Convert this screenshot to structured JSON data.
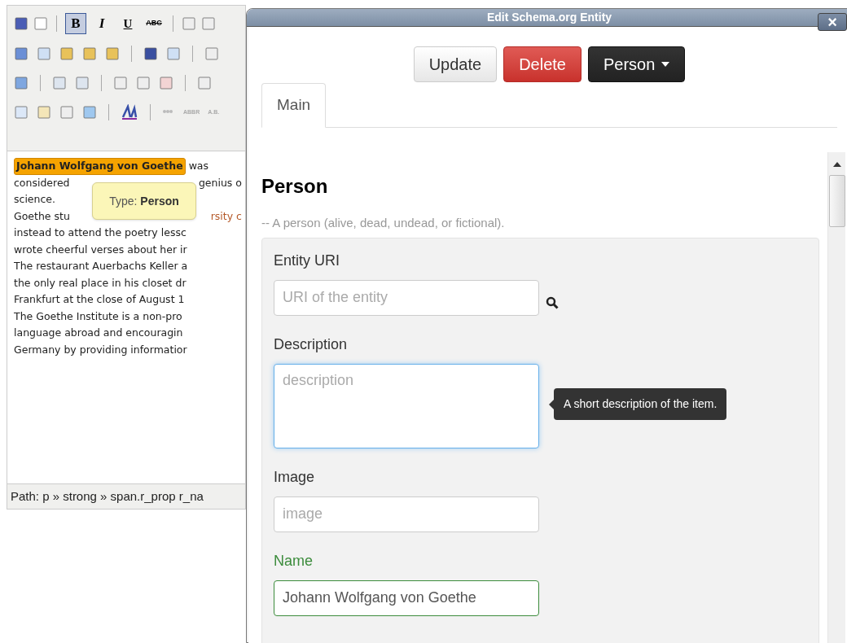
{
  "editor": {
    "format_buttons": [
      {
        "label": "B",
        "selected": true
      },
      {
        "label": "I",
        "selected": false
      },
      {
        "label": "U",
        "selected": false
      },
      {
        "label": "ABC",
        "selected": false
      }
    ],
    "small_buttons": [
      "ABBR",
      "A.B."
    ],
    "entity": "Johann Wolfgang von Goethe",
    "after_entity": "was",
    "lines": [
      {
        "left": "considered",
        "right": "genius o"
      },
      {
        "left": "science."
      },
      {
        "left": "Goethe stu",
        "right": "rsity c",
        "kind": "link"
      },
      {
        "left": "instead to attend the poetry lessc"
      },
      {
        "left": "wrote cheerful verses about her ir"
      },
      {
        "left": "The restaurant Auerbachs Keller a"
      },
      {
        "left": "the only real place in his closet dr"
      },
      {
        "left": "Frankfurt at the close of August 1"
      },
      {
        "left": "The Goethe Institute is a non-pro"
      },
      {
        "left": "language abroad and encouragin"
      },
      {
        "left": "Germany by providing informatior"
      }
    ],
    "type_tooltip": {
      "label": "Type:",
      "value": "Person"
    },
    "path": "Path: p » strong » span.r_prop r_na"
  },
  "dialog": {
    "title": "Edit Schema.org Entity",
    "close": "×",
    "buttons": [
      {
        "label": "Update",
        "kind": "default"
      },
      {
        "label": "Delete",
        "kind": "danger"
      },
      {
        "label": "Person",
        "kind": "dropdown"
      }
    ],
    "tabs": [
      {
        "label": "Main",
        "selected": true
      }
    ],
    "heading": "Person",
    "description": "-- A person (alive, dead, undead, or fictional).",
    "fields": [
      {
        "label": "Entity URI",
        "kind": "input",
        "placeholder": "URI of the entity",
        "focused": false,
        "valid": false,
        "search_button": true
      },
      {
        "label": "Description",
        "kind": "textarea",
        "placeholder": "description",
        "focused": true,
        "valid": false,
        "tooltip": "A short description of the item."
      },
      {
        "label": "Image",
        "kind": "input",
        "placeholder": "image",
        "focused": false,
        "valid": false
      },
      {
        "label": "Name",
        "kind": "input",
        "value": "Johann Wolfgang von Goethe",
        "focused": false,
        "valid": true
      }
    ]
  }
}
